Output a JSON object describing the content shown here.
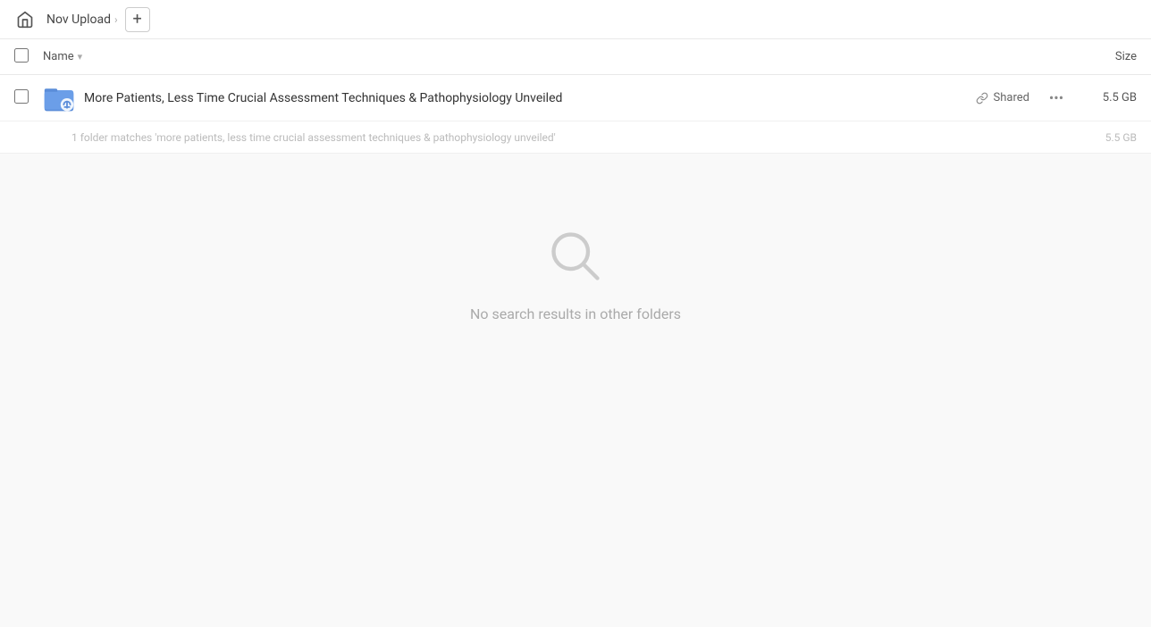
{
  "topbar": {
    "home_label": "Home",
    "breadcrumb": [
      {
        "label": "Nov Upload",
        "arrow": "›"
      }
    ],
    "add_button_label": "+"
  },
  "columns": {
    "name_label": "Name",
    "name_sort_icon": "▾",
    "size_label": "Size"
  },
  "files": [
    {
      "name": "More Patients, Less Time Crucial Assessment Techniques & Pathophysiology Unveiled",
      "shared_label": "Shared",
      "size": "5.5 GB",
      "more_icon": "···"
    }
  ],
  "summary": {
    "text": "1 folder matches 'more patients, less time crucial assessment techniques & pathophysiology unveiled'",
    "size": "5.5 GB"
  },
  "empty_state": {
    "message": "No search results in other folders"
  }
}
